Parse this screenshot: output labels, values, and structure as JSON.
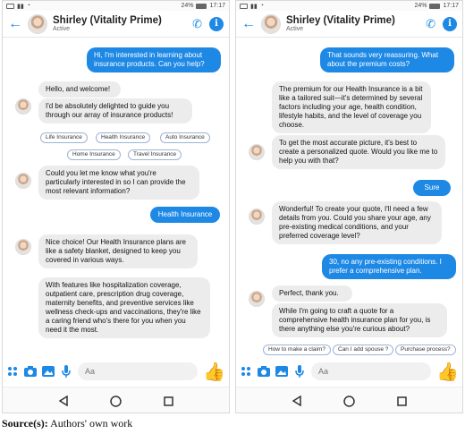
{
  "status": {
    "battery": "24%",
    "time": "17:17"
  },
  "contact": {
    "name": "Shirley (Vitality Prime)",
    "status": "Active"
  },
  "composer": {
    "placeholder": "Aa"
  },
  "left": {
    "messages": [
      {
        "from": "user",
        "text": "Hi, I'm interested in learning about insurance products. Can you help?"
      },
      {
        "from": "bot",
        "text": "Hello, and welcome!"
      },
      {
        "from": "bot",
        "text": "I'd be absolutely delighted to guide you through our array of insurance products!"
      },
      {
        "from": "bot",
        "text": "Could you let me know what you're particularly interested in so I can provide the most relevant information?"
      },
      {
        "from": "user",
        "text": "Health Insurance"
      },
      {
        "from": "bot",
        "text": "Nice choice! Our Health Insurance plans are like a safety blanket, designed to keep you covered in various ways."
      },
      {
        "from": "bot",
        "text": "With features like hospitalization coverage, outpatient care, prescription drug coverage, maternity benefits, and preventive services like wellness check-ups and vaccinations, they're like a caring friend who's there for you when you need it the most."
      }
    ],
    "chips": [
      "Life Insurance",
      "Health Insurance",
      "Auto Insurance",
      "Home Insurance",
      "Travel Insurance"
    ]
  },
  "right": {
    "messages": [
      {
        "from": "user",
        "text": "That sounds very reassuring. What about the premium costs?"
      },
      {
        "from": "bot",
        "text": "The premium for our Health Insurance is a bit like a tailored suit—it's determined by several factors including your age, health condition, lifestyle habits, and the level of coverage you choose."
      },
      {
        "from": "bot",
        "text": "To get the most accurate picture, it's best to create a personalized quote. Would you like me to help you with that?"
      },
      {
        "from": "user",
        "text": "Sure"
      },
      {
        "from": "bot",
        "text": "Wonderful! To create your quote, I'll need a few details from you. Could you share your age, any pre-existing medical conditions, and your preferred coverage level?"
      },
      {
        "from": "user",
        "text": "30, no any pre-existing conditions. I prefer a comprehensive plan."
      },
      {
        "from": "bot",
        "text": "Perfect, thank you."
      },
      {
        "from": "bot",
        "text": "While I'm going to craft a quote for a comprehensive health insurance plan for you, is there anything else you're curious about?"
      }
    ],
    "chips": [
      "How to make a claim?",
      "Can I add spouse ?",
      "Purchase process?"
    ]
  },
  "caption": {
    "label": "Source(s):",
    "text": "Authors' own work"
  },
  "colors": {
    "accent": "#1e88e5",
    "bot_bubble": "#ececec"
  }
}
